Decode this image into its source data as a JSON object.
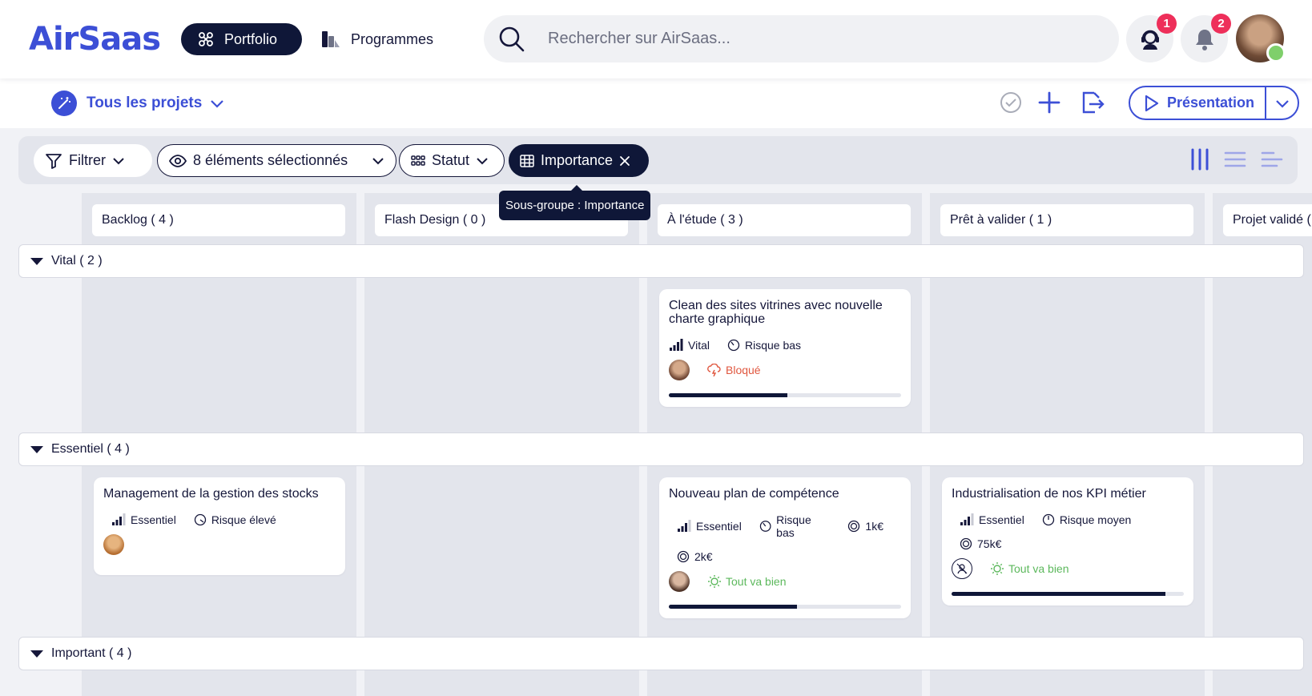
{
  "app": {
    "logo": "AirSaas"
  },
  "nav": {
    "portfolio": "Portfolio",
    "programmes": "Programmes",
    "search_placeholder": "Rechercher sur AirSaas...",
    "support_badge": "1",
    "notif_badge": "2"
  },
  "subbar": {
    "project_selector": "Tous les projets",
    "presentation": "Présentation"
  },
  "filters": {
    "filter": "Filtrer",
    "visible": "8 éléments sélectionnés",
    "statut": "Statut",
    "importance": "Importance",
    "tooltip": "Sous-groupe : Importance"
  },
  "columns": [
    "Backlog ( 4 )",
    "Flash Design ( 0 )",
    "À l'étude ( 3 )",
    "Prêt à valider ( 1 )",
    "Projet validé ("
  ],
  "groups": [
    "Vital ( 2 )",
    "Essentiel ( 4 )",
    "Important ( 4 )"
  ],
  "cards": [
    {
      "title": "Clean des sites vitrines avec nouvelle charte graphique",
      "importance": "Vital",
      "risk": "Risque bas",
      "mood": "Bloqué",
      "mood_color": "#e0573f",
      "progress": 0.51
    },
    {
      "title": "Management de la gestion des stocks",
      "importance": "Essentiel",
      "risk": "Risque élevé"
    },
    {
      "title": "Nouveau plan de compétence",
      "importance": "Essentiel",
      "risk": "Risque bas",
      "budget1": "1k€",
      "budget2": "2k€",
      "mood": "Tout va bien",
      "mood_color": "#5cb85c",
      "progress": 0.55
    },
    {
      "title": "Industrialisation de nos KPI métier",
      "importance": "Essentiel",
      "risk": "Risque moyen",
      "budget2": "75k€",
      "mood": "Tout va bien",
      "mood_color": "#5cb85c",
      "progress": 0.92
    }
  ],
  "colors": {
    "brand": "#3c4fd6",
    "dark": "#0f1738",
    "badge": "#ee2f5a"
  }
}
